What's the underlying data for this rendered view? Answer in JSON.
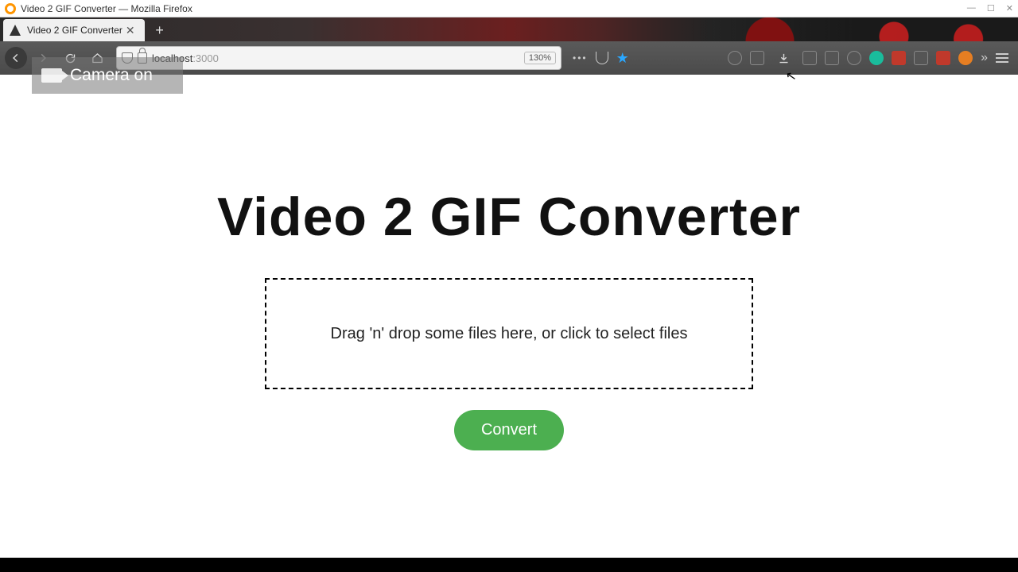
{
  "os": {
    "window_title": "Video 2 GIF Converter — Mozilla Firefox",
    "minimize": "—",
    "maximize": "☐",
    "close": "✕"
  },
  "browser": {
    "tab_title": "Video 2 GIF Converter",
    "tab_close": "✕",
    "new_tab": "+",
    "url_host": "localhost",
    "url_port": ":3000",
    "zoom": "130%",
    "menu_dots": "•••"
  },
  "overlay": {
    "camera_status": "Camera on"
  },
  "content": {
    "heading": "Video 2 GIF Converter",
    "dropzone_text": "Drag 'n' drop some files here, or click to select files",
    "convert_label": "Convert"
  }
}
